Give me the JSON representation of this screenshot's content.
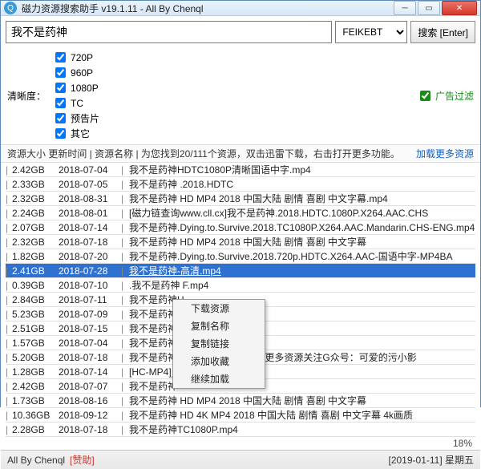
{
  "titlebar": {
    "title": "磁力资源搜索助手 v19.1.11 - All By Chenql"
  },
  "search": {
    "query": "我不是药神",
    "source": "FEIKEBT",
    "button_label": "搜索 [Enter]"
  },
  "filters": {
    "label": "清晰度：",
    "items": [
      "720P",
      "960P",
      "1080P",
      "TC",
      "预告片",
      "其它"
    ],
    "ad_label": "广告过滤"
  },
  "header": {
    "cols": "资源大小 更新时间 | 资源名称 | 为您找到20/111个资源，双击迅雷下载，右击打开更多功能。",
    "more": "加载更多资源"
  },
  "context_menu": [
    "下载资源",
    "复制名称",
    "复制链接",
    "添加收藏",
    "继续加载"
  ],
  "progress": "18%",
  "status": {
    "credit": "All By Chenql",
    "donate": "[赞助]",
    "date": "[2019-01-11]  星期五"
  },
  "selected_index": 7,
  "rows": [
    {
      "size": "2.42GB",
      "date": "2018-07-04",
      "name": "我不是药神HDTC1080P清晰国语中字.mp4"
    },
    {
      "size": "2.33GB",
      "date": "2018-07-05",
      "name": "我不是药神 .2018.HDTC"
    },
    {
      "size": "2.32GB",
      "date": "2018-08-31",
      "name": "我不是药神 HD MP4 2018 中国大陆 剧情 喜剧 中文字幕.mp4"
    },
    {
      "size": "2.24GB",
      "date": "2018-08-01",
      "name": "[磁力链查询www.cll.cx]我不是药神.2018.HDTC.1080P.X264.AAC.CHS"
    },
    {
      "size": "2.07GB",
      "date": "2018-07-14",
      "name": "我不是药神.Dying.to.Survive.2018.TC1080P.X264.AAC.Mandarin.CHS-ENG.mp4"
    },
    {
      "size": "2.32GB",
      "date": "2018-07-18",
      "name": "我不是药神 HD MP4 2018 中国大陆 剧情 喜剧 中文字幕"
    },
    {
      "size": "1.82GB",
      "date": "2018-07-20",
      "name": "我不是药神.Dying.to.Survive.2018.720p.HDTC.X264.AAC-国语中字-MP4BA"
    },
    {
      "size": "2.41GB",
      "date": "2018-07-28",
      "name": "我不是药神-高清.mp4"
    },
    {
      "size": "0.39GB",
      "date": "2018-07-10",
      "name": ".我不是药神                                          F.mp4"
    },
    {
      "size": "2.84GB",
      "date": "2018-07-11",
      "name": "我不是药神H"
    },
    {
      "size": "5.23GB",
      "date": "2018-07-09",
      "name": "我不是药神H"
    },
    {
      "size": "2.51GB",
      "date": "2018-07-15",
      "name": "我不是药神H"
    },
    {
      "size": "1.57GB",
      "date": "2018-07-04",
      "name": "我不是药神H"
    },
    {
      "size": "5.20GB",
      "date": "2018-07-18",
      "name": "我不是药神.2018.720P国语中字更多资源关注G众号：可爱的污小影"
    },
    {
      "size": "1.28GB",
      "date": "2018-07-14",
      "name": "[HC-MP4]_1.28GB"
    },
    {
      "size": "2.42GB",
      "date": "2018-07-07",
      "name": "我不是药神"
    },
    {
      "size": "1.73GB",
      "date": "2018-08-16",
      "name": "我不是药神 HD MP4 2018 中国大陆 剧情 喜剧 中文字幕"
    },
    {
      "size": "10.36GB",
      "date": "2018-09-12",
      "name": "我不是药神 HD 4K MP4 2018 中国大陆 剧情 喜剧 中文字幕 4k画质"
    },
    {
      "size": "2.28GB",
      "date": "2018-07-18",
      "name": "我不是药神TC1080P.mp4"
    }
  ]
}
